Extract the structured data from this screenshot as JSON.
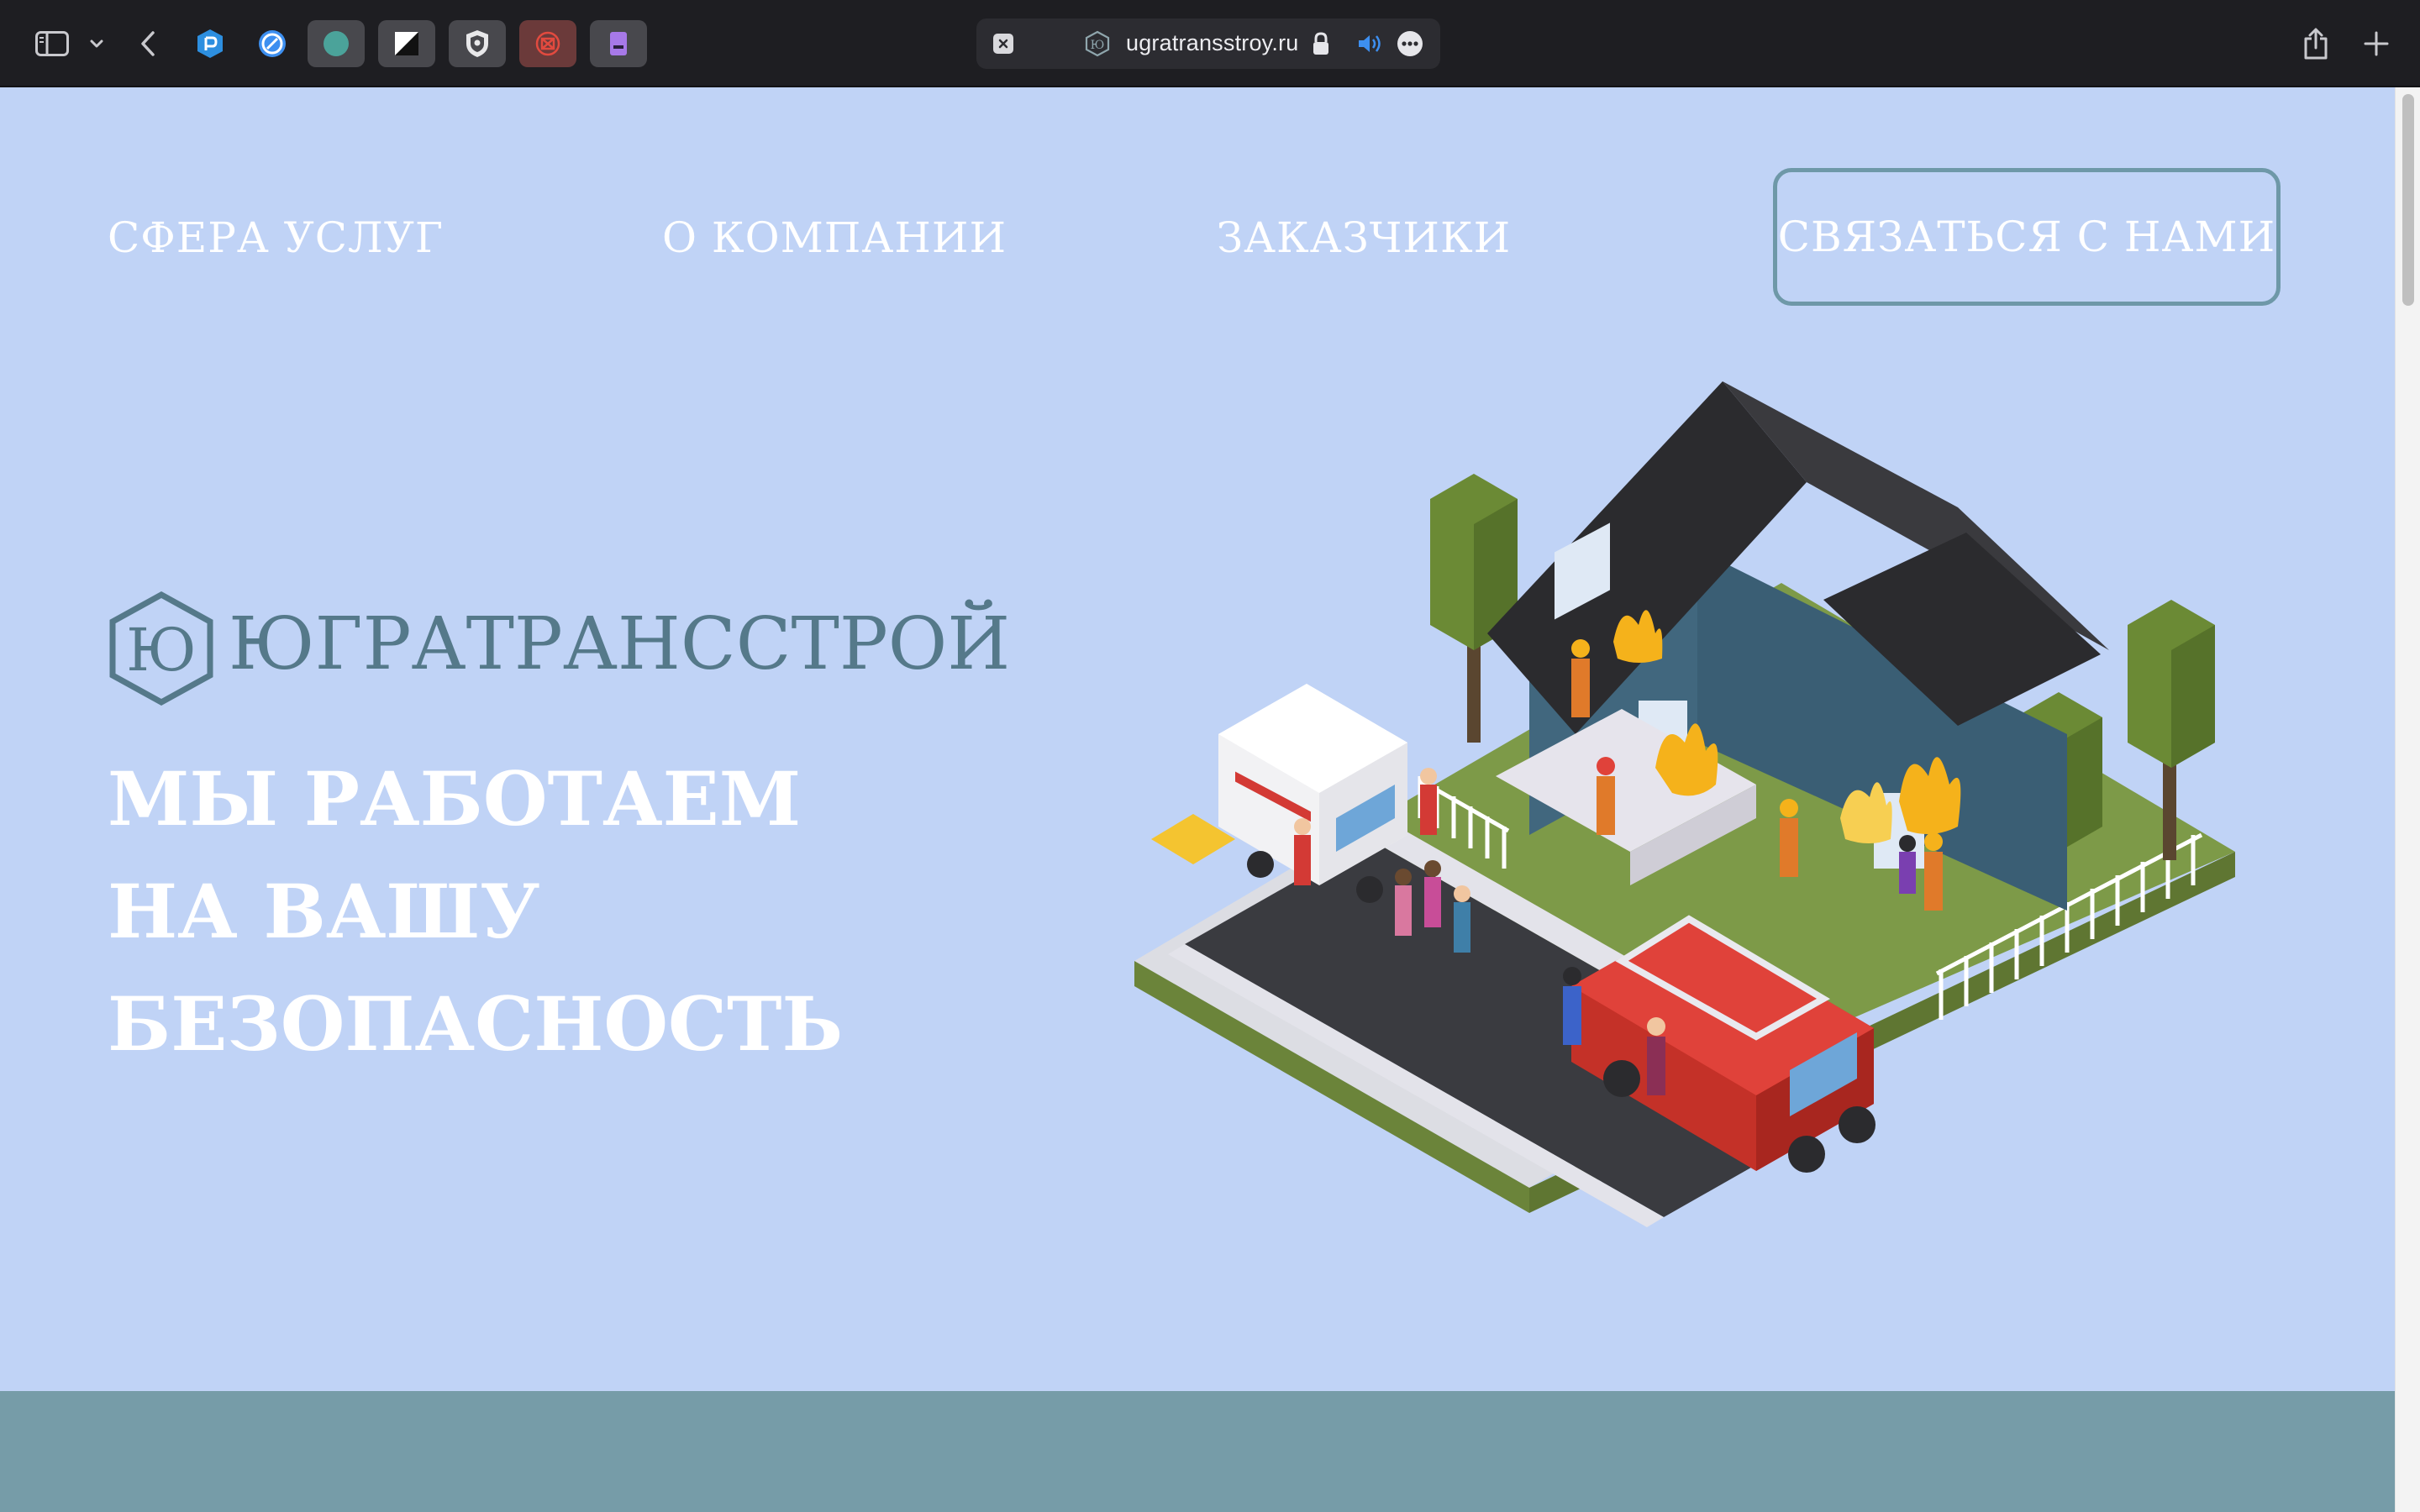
{
  "browser": {
    "url": "ugratransstroy.ru",
    "icons": {
      "sidebar": "sidebar-icon",
      "tab_menu": "chevron-down-icon",
      "back": "chevron-left-icon",
      "share": "share-icon",
      "new_tab": "plus-icon",
      "lock": "lock-icon",
      "audio": "speaker-icon",
      "more": "more-icon"
    },
    "extensions": [
      "hexagon-extension-icon",
      "compass-extension-icon",
      "circle-extension-icon",
      "contrast-extension-icon",
      "shield-extension-icon",
      "openai-extension-icon",
      "purple-extension-icon"
    ]
  },
  "nav": {
    "services": "СФЕРА УСЛУГ",
    "about": "О КОМПАНИИ",
    "clients": "ЗАКАЗЧИКИ",
    "contact": "СВЯЗАТЬСЯ С НАМИ"
  },
  "logo": {
    "mark_letter": "Ю",
    "name": "ЮГРАТРАНССТРОЙ"
  },
  "hero": {
    "headline": [
      "МЫ РАБОТАЕМ",
      "НА ВАШУ",
      "БЕЗОПАСНОСТЬ"
    ],
    "illustration": "isometric fire rescue scene with burning house, fire truck, ambulance and people"
  },
  "colors": {
    "page_background": "#c0d3f6",
    "accent": "#55798a",
    "band": "#769ca8",
    "button_border": "#6e98a8"
  }
}
